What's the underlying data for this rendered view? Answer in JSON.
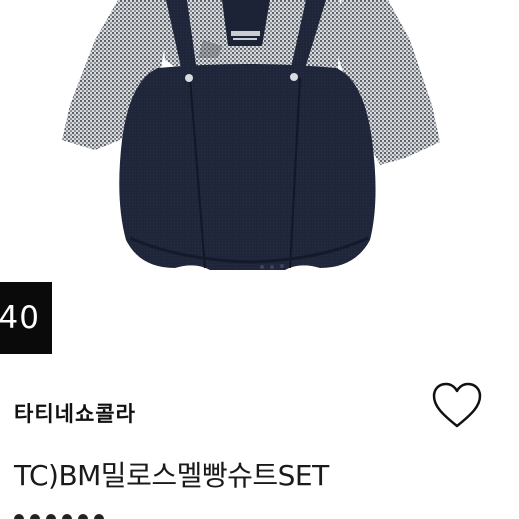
{
  "product": {
    "discount": "40",
    "brand": "타티네쇼콜라",
    "title": "TC)BM밀로스멜빵슈트SET",
    "wishlist_icon": "heart-outline-icon"
  },
  "colors": {
    "shirt_check": "#6b6f76",
    "shorts_navy": "#1d2437",
    "badge_bg": "#0a0a0a",
    "text": "#111111"
  }
}
